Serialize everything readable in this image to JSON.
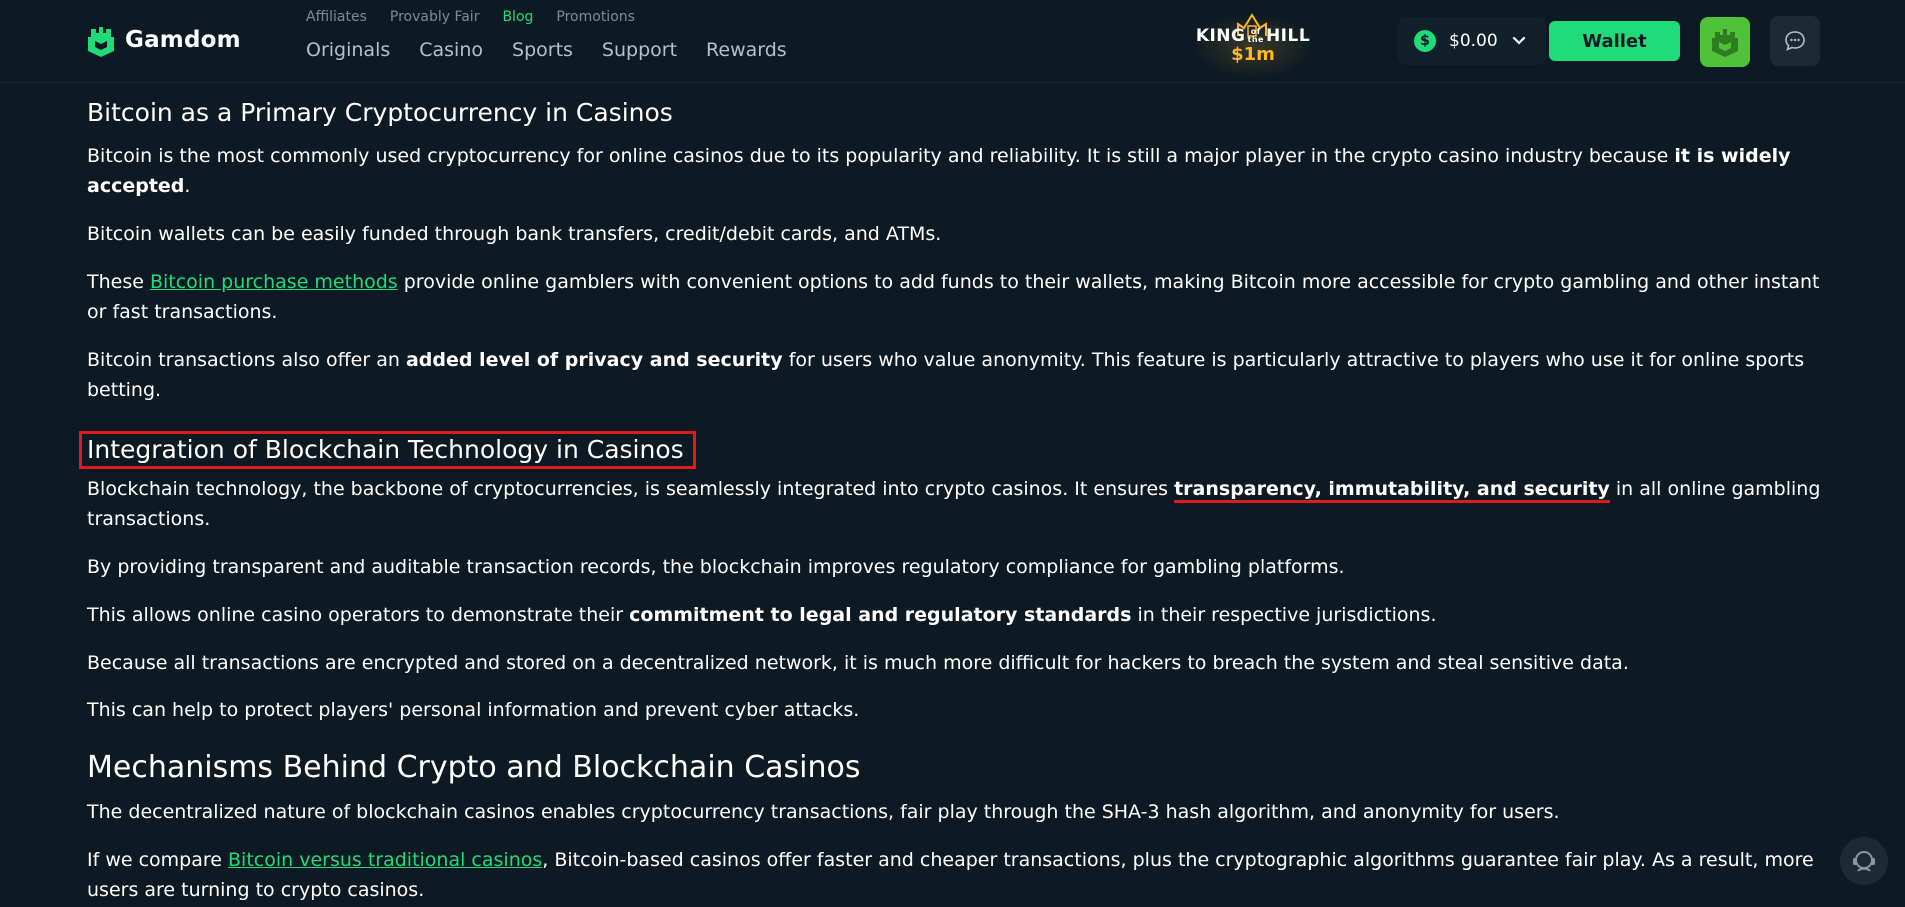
{
  "header": {
    "logo_text": "Gamdom",
    "subnav": [
      "Affiliates",
      "Provably Fair",
      "Blog",
      "Promotions"
    ],
    "active_subnav": "Blog",
    "mainnav": [
      "Originals",
      "Casino",
      "Sports",
      "Support",
      "Rewards"
    ],
    "promo": {
      "title_left": "KING",
      "title_of": "of",
      "title_the": "the",
      "title_right": "HILL",
      "prize": "$1m"
    },
    "balance": {
      "currency_symbol": "$",
      "amount": "$0.00"
    },
    "wallet_label": "Wallet"
  },
  "article": {
    "section1": {
      "heading": "Bitcoin as a Primary Cryptocurrency in Casinos",
      "p1_text": "Bitcoin is the most commonly used cryptocurrency for online casinos due to its popularity and reliability. It is still a major player in the crypto casino industry because ",
      "p1_bold": "it is widely accepted",
      "p1_end": ".",
      "p2": "Bitcoin wallets can be easily funded through bank transfers, credit/debit cards, and ATMs.",
      "p3_start": "These ",
      "p3_link": "Bitcoin purchase methods",
      "p3_end": " provide online gamblers with convenient options to add funds to their wallets, making Bitcoin more accessible for crypto gambling and other instant or fast transactions.",
      "p4_start": "Bitcoin transactions also offer an ",
      "p4_bold": "added level of privacy and security",
      "p4_end": " for users who value anonymity. This feature is particularly attractive to players who use it for online sports betting."
    },
    "section2": {
      "heading": "Integration of Blockchain Technology in Casinos",
      "p1_start": "Blockchain technology, the backbone of cryptocurrencies, is seamlessly integrated into crypto casinos. It ensures ",
      "p1_bold": "transparency, immutability, and security",
      "p1_end": " in all online gambling transactions.",
      "p2": "By providing transparent and auditable transaction records, the blockchain improves regulatory compliance for gambling platforms.",
      "p3_start": "This allows online casino operators to demonstrate their ",
      "p3_bold": "commitment to legal and regulatory standards",
      "p3_end": " in their respective jurisdictions.",
      "p4": "Because all transactions are encrypted and stored on a decentralized network, it is much more difficult for hackers to breach the system and steal sensitive data.",
      "p5": "This can help to protect players' personal information and prevent cyber attacks."
    },
    "section3": {
      "heading": "Mechanisms Behind Crypto and Blockchain Casinos",
      "p1": "The decentralized nature of blockchain casinos enables cryptocurrency transactions, fair play through the SHA-3 hash algorithm, and anonymity for users.",
      "p2_start": "If we compare ",
      "p2_link": "Bitcoin versus traditional casinos",
      "p2_end": ", Bitcoin-based casinos offer faster and cheaper transactions, plus the cryptographic algorithms guarantee fair play. As a result, more users are turning to crypto casinos."
    }
  },
  "colors": {
    "background": "#0e1a23",
    "accent": "#1fdb7a",
    "annotation_red": "#e11a1a",
    "promo_gold": "#ffb627"
  },
  "icons": [
    "gamdom-logo-icon",
    "dollar-coin-icon",
    "chevron-down-icon",
    "king-of-the-hill-crown-icon",
    "user-avatar-icon",
    "chat-icon",
    "support-agent-icon"
  ]
}
